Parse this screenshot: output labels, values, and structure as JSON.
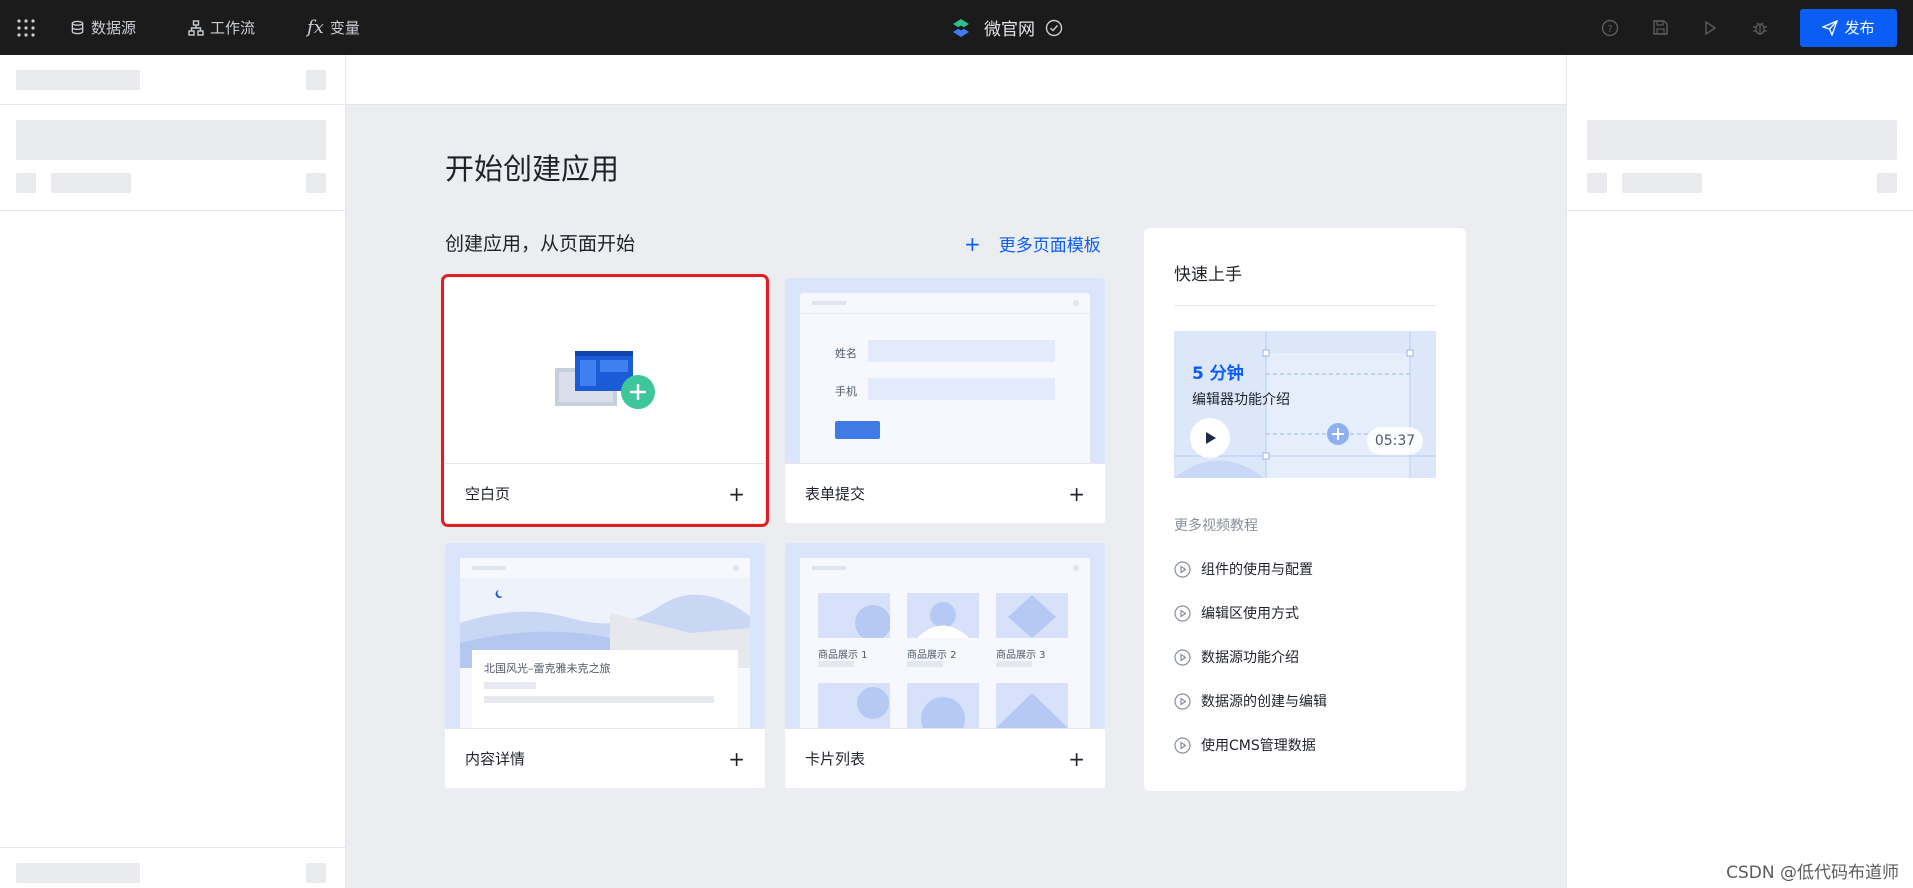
{
  "topbar": {
    "nav": [
      {
        "label": "数据源",
        "icon": "database-icon"
      },
      {
        "label": "工作流",
        "icon": "workflow-icon"
      },
      {
        "label": "变量",
        "icon": "fx-icon"
      }
    ],
    "app_name": "微官网",
    "publish_label": "发布",
    "right_icons": [
      "help-icon",
      "save-icon",
      "play-icon",
      "bug-icon"
    ]
  },
  "main": {
    "title": "开始创建应用",
    "section_title": "创建应用，从页面开始",
    "more_templates": "更多页面模板",
    "cards": [
      {
        "label": "空白页",
        "selected": true
      },
      {
        "label": "表单提交",
        "form": {
          "name_label": "姓名",
          "phone_label": "手机"
        }
      },
      {
        "label": "内容详情",
        "article_title": "北国风光–雷克雅未克之旅"
      },
      {
        "label": "卡片列表",
        "items": [
          "商品展示 1",
          "商品展示 2",
          "商品展示 3"
        ]
      }
    ]
  },
  "quickstart": {
    "title": "快速上手",
    "video": {
      "minutes": "5 分钟",
      "subtitle": "编辑器功能介绍",
      "duration": "05:37"
    },
    "more_title": "更多视频教程",
    "tutorials": [
      "组件的使用与配置",
      "编辑区使用方式",
      "数据源功能介绍",
      "数据源的创建与编辑",
      "使用CMS管理数据"
    ]
  },
  "watermark": "CSDN @低代码布道师",
  "colors": {
    "accent": "#0a5ef5",
    "selected_border": "#e02020",
    "topbar": "#1b1b1b"
  }
}
